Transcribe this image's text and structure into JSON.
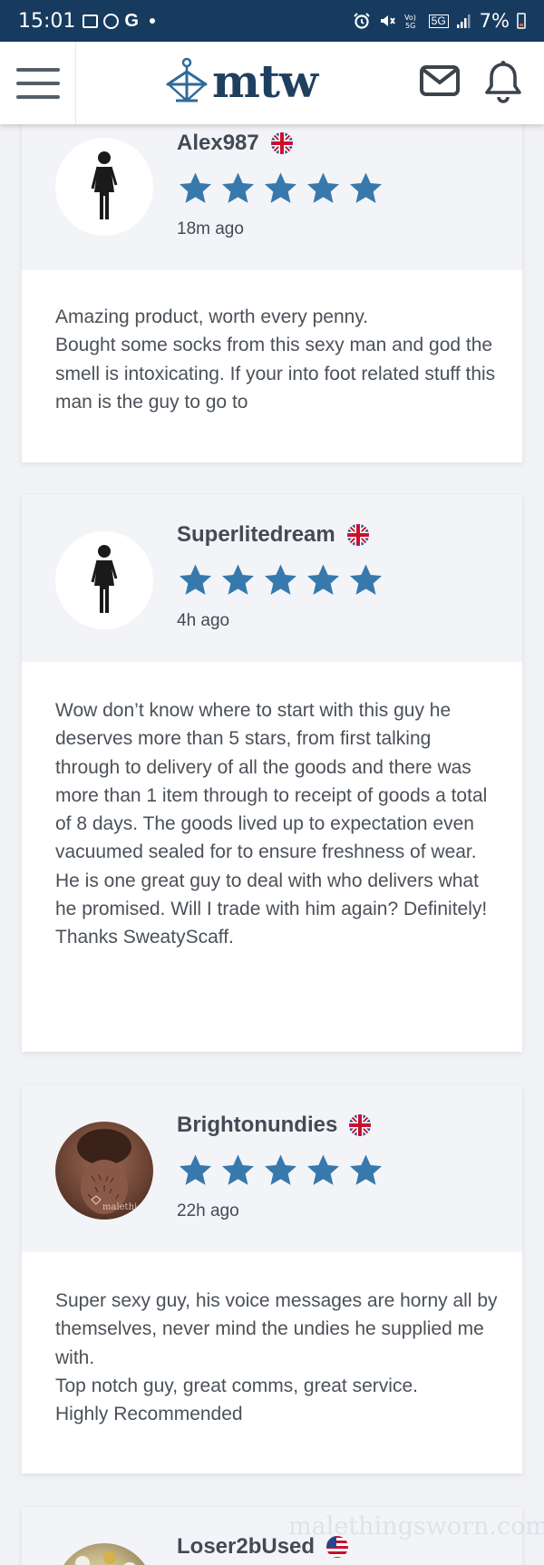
{
  "status_bar": {
    "time": "15:01",
    "battery_pct": "7%",
    "net_label": "5G"
  },
  "header": {
    "logo_text": "mtw"
  },
  "reviews": [
    {
      "username": "Alex987",
      "country_flag": "uk-flag-icon",
      "rating": 5,
      "time_ago": "18m ago",
      "text": "Amazing product, worth every penny.\nBought some socks from this sexy man and god the smell is intoxicating. If your into foot related stuff this man is the guy to go to"
    },
    {
      "username": "Superlitedream",
      "country_flag": "uk-flag-icon",
      "rating": 5,
      "time_ago": "4h ago",
      "text": "Wow don’t know where to start with this guy he deserves more than 5 stars, from first talking through to delivery of all the goods and there was more than 1 item through to receipt of goods a total of 8 days. The goods lived up to expectation even vacuumed sealed for to ensure freshness of wear. He is one great guy to deal with who delivers what he promised. Will I trade with him again? Definitely!\nThanks SweatyScaff."
    },
    {
      "username": "Brightonundies",
      "country_flag": "uk-flag-icon",
      "rating": 5,
      "time_ago": "22h ago",
      "text": "Super sexy guy, his voice messages are horny all by themselves, never mind the undies he supplied me with.\nTop notch guy, great comms, great service.\nHighly Recommended",
      "avatar_watermark": "malethi"
    },
    {
      "username": "Loser2bUsed",
      "country_flag": "us-flag-icon"
    }
  ],
  "watermark_text": "malethingsworn.com",
  "colors": {
    "star": "#3779ad",
    "status_bar": "#173b5f",
    "logo": "#1f3f5f"
  }
}
